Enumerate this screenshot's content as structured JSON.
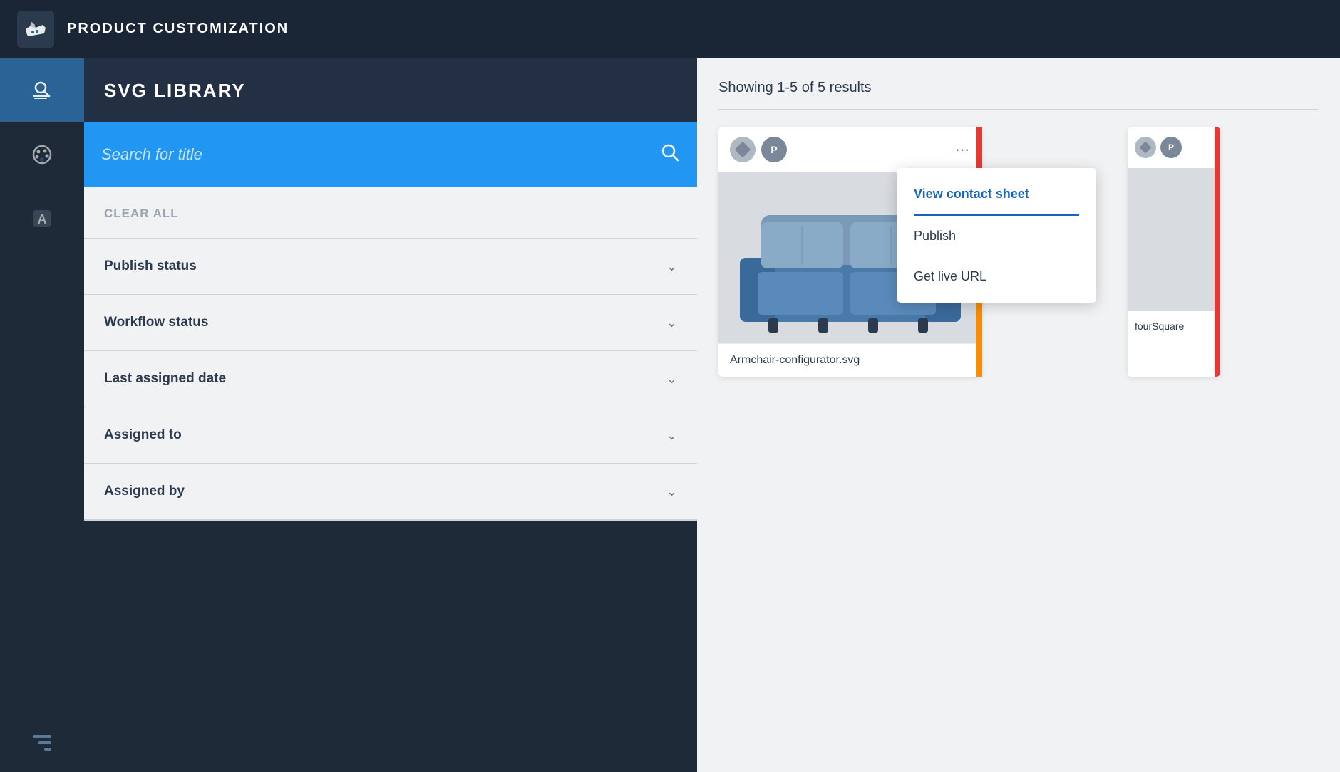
{
  "header": {
    "app_title": "PRODUCT CUSTOMIZATION"
  },
  "sidebar": {
    "items": [
      {
        "id": "library",
        "label": "Library",
        "icon": "library-icon",
        "active": true
      },
      {
        "id": "colors",
        "label": "Colors",
        "icon": "palette-icon",
        "active": false
      },
      {
        "id": "text",
        "label": "Text",
        "icon": "text-icon",
        "active": false
      }
    ]
  },
  "filter_panel": {
    "section_title": "SVG LIBRARY",
    "search_placeholder": "Search for title",
    "clear_all_label": "CLEAR ALL",
    "filters": [
      {
        "id": "publish-status",
        "label": "Publish status"
      },
      {
        "id": "workflow-status",
        "label": "Workflow status"
      },
      {
        "id": "last-assigned-date",
        "label": "Last assigned date"
      },
      {
        "id": "assigned-to",
        "label": "Assigned to"
      },
      {
        "id": "assigned-by",
        "label": "Assigned by"
      }
    ]
  },
  "content": {
    "results_text": "Showing 1-5 of 5 results",
    "cards": [
      {
        "id": "card-1",
        "filename": "Armchair-configurator.svg",
        "has_menu": true
      },
      {
        "id": "card-2",
        "filename": "fourSquare",
        "has_menu": false
      }
    ],
    "context_menu": {
      "items": [
        {
          "id": "view-contact-sheet",
          "label": "View contact sheet",
          "active": true
        },
        {
          "id": "publish",
          "label": "Publish",
          "active": false
        },
        {
          "id": "get-live-url",
          "label": "Get live URL",
          "active": false
        }
      ]
    }
  }
}
